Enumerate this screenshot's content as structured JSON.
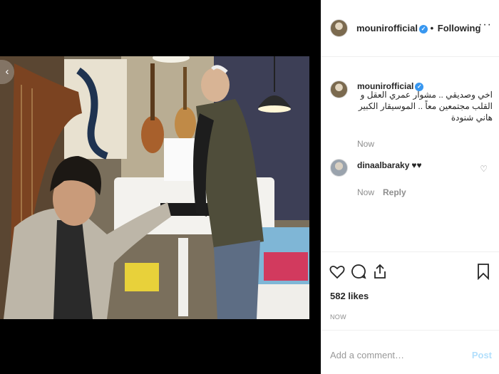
{
  "post": {
    "username": "mounirofficial",
    "verified_icon": "verified-badge-icon",
    "separator": "•",
    "follow_label": "Following",
    "more_label": "···",
    "nav_prev_label": "‹"
  },
  "caption": {
    "username": "mounirofficial",
    "text": "اخي وصديقي .. مشوار عمري العقل و القلب مجتمعين معاً .. الموسيقار الكبير هاني شنودة",
    "time": "Now"
  },
  "comments": [
    {
      "username": "dinaalbaraky",
      "text": "♥♥",
      "time": "Now",
      "reply_label": "Reply"
    }
  ],
  "actions": {
    "likes": "582 likes",
    "posted": "NOW"
  },
  "composer": {
    "placeholder": "Add a comment…",
    "post_label": "Post"
  },
  "colors": {
    "link_blue": "#3897f0",
    "post_disabled": "#b2dffc",
    "muted": "#8e8e8e"
  }
}
